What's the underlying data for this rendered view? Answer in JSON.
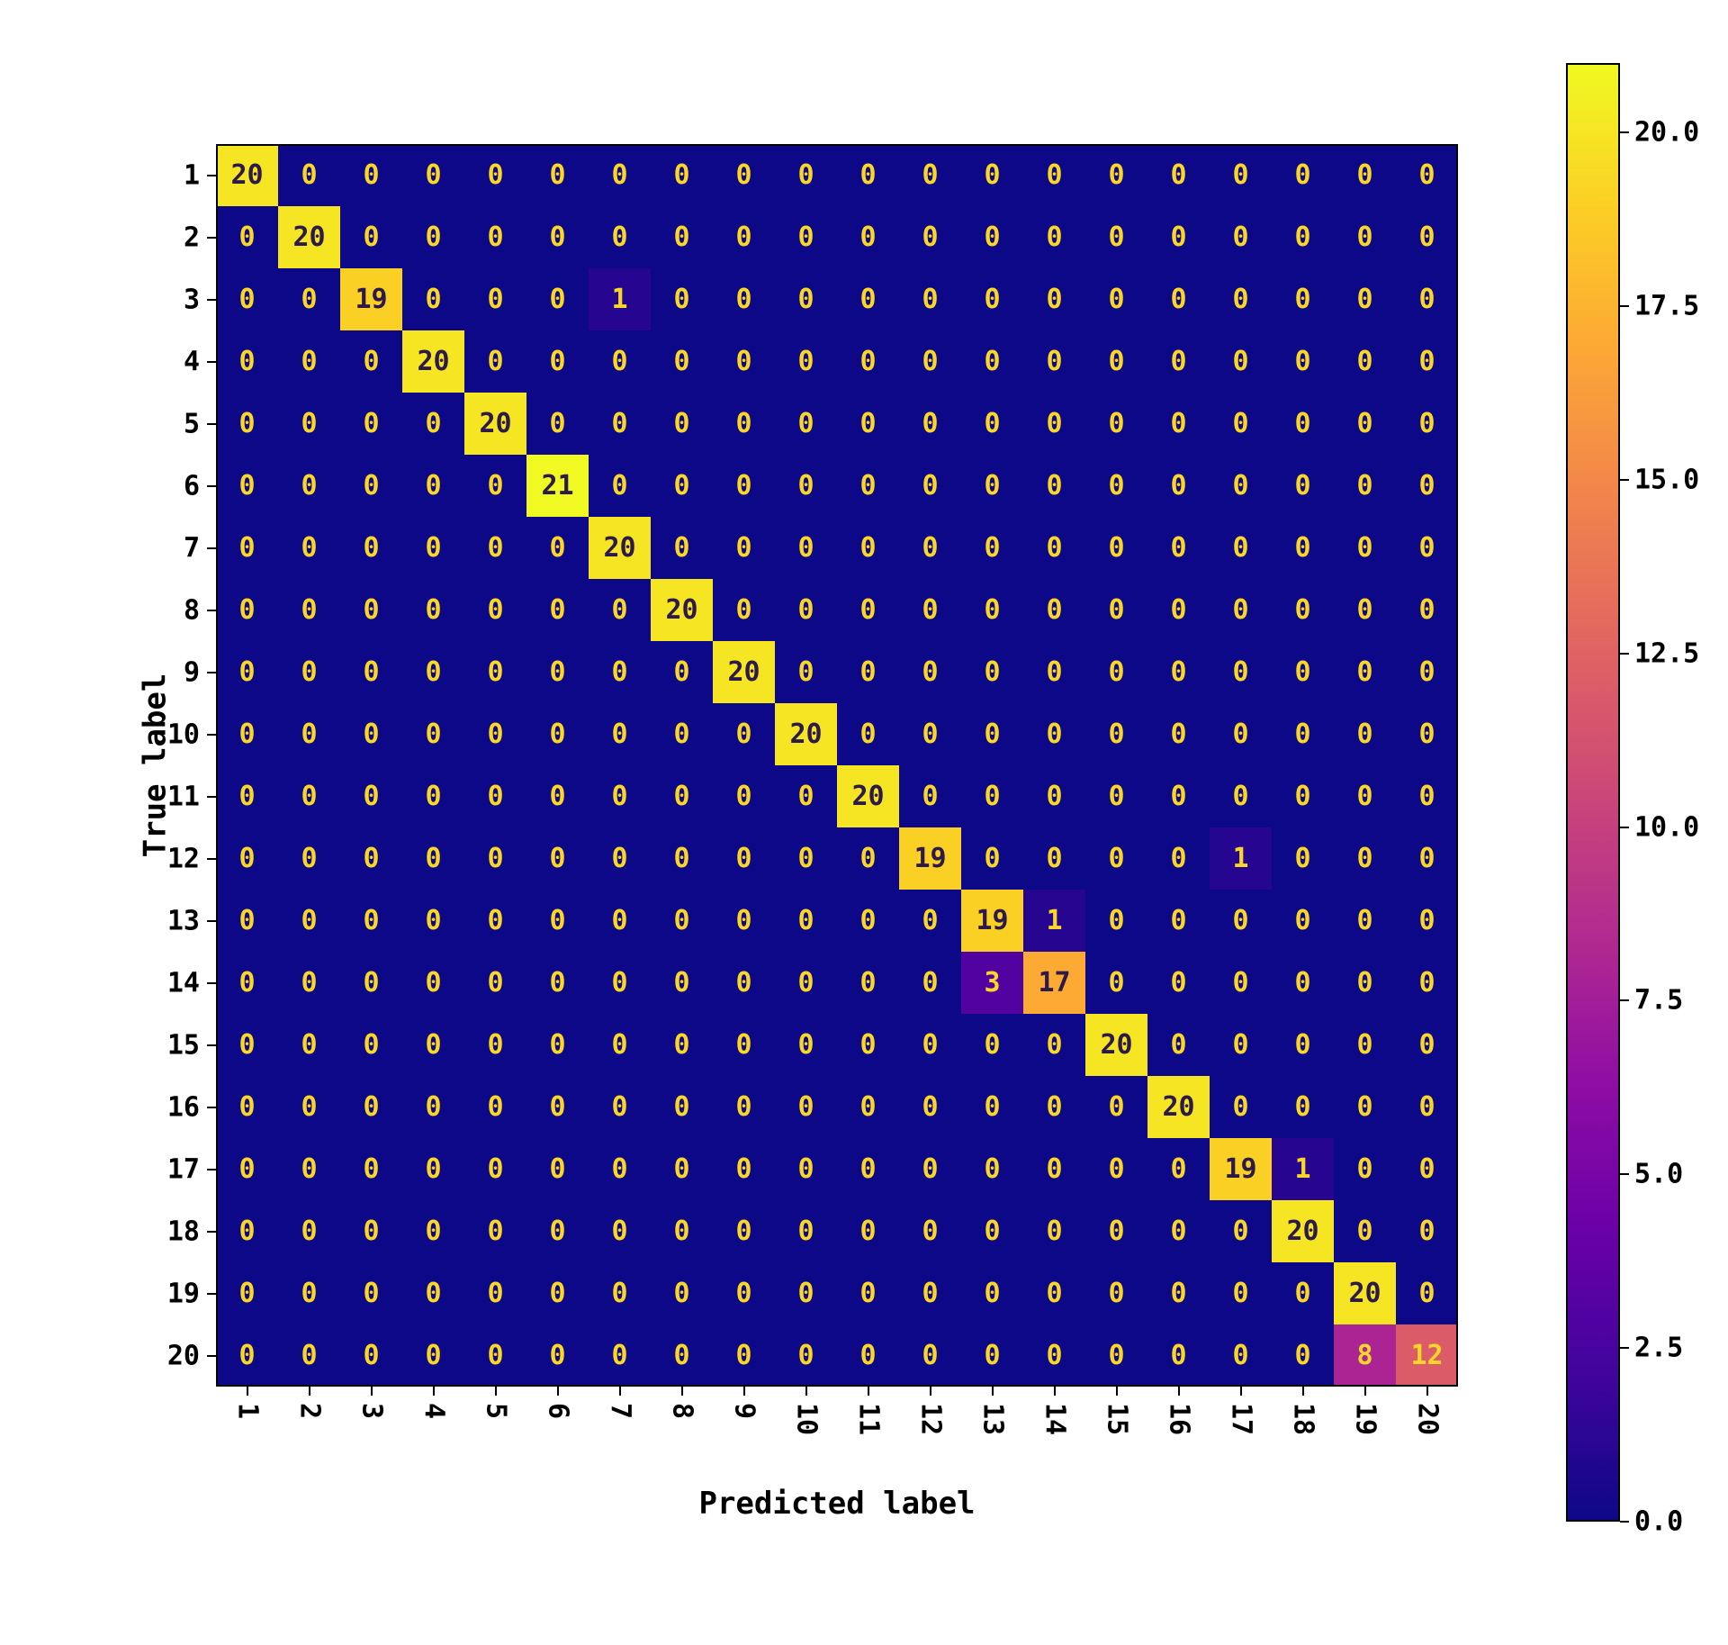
{
  "chart_data": {
    "type": "heatmap",
    "xlabel": "Predicted label",
    "ylabel": "True label",
    "categories_x": [
      "1",
      "2",
      "3",
      "4",
      "5",
      "6",
      "7",
      "8",
      "9",
      "10",
      "11",
      "12",
      "13",
      "14",
      "15",
      "16",
      "17",
      "18",
      "19",
      "20"
    ],
    "categories_y": [
      "1",
      "2",
      "3",
      "4",
      "5",
      "6",
      "7",
      "8",
      "9",
      "10",
      "11",
      "12",
      "13",
      "14",
      "15",
      "16",
      "17",
      "18",
      "19",
      "20"
    ],
    "matrix": [
      [
        20,
        0,
        0,
        0,
        0,
        0,
        0,
        0,
        0,
        0,
        0,
        0,
        0,
        0,
        0,
        0,
        0,
        0,
        0,
        0
      ],
      [
        0,
        20,
        0,
        0,
        0,
        0,
        0,
        0,
        0,
        0,
        0,
        0,
        0,
        0,
        0,
        0,
        0,
        0,
        0,
        0
      ],
      [
        0,
        0,
        19,
        0,
        0,
        0,
        1,
        0,
        0,
        0,
        0,
        0,
        0,
        0,
        0,
        0,
        0,
        0,
        0,
        0
      ],
      [
        0,
        0,
        0,
        20,
        0,
        0,
        0,
        0,
        0,
        0,
        0,
        0,
        0,
        0,
        0,
        0,
        0,
        0,
        0,
        0
      ],
      [
        0,
        0,
        0,
        0,
        20,
        0,
        0,
        0,
        0,
        0,
        0,
        0,
        0,
        0,
        0,
        0,
        0,
        0,
        0,
        0
      ],
      [
        0,
        0,
        0,
        0,
        0,
        21,
        0,
        0,
        0,
        0,
        0,
        0,
        0,
        0,
        0,
        0,
        0,
        0,
        0,
        0
      ],
      [
        0,
        0,
        0,
        0,
        0,
        0,
        20,
        0,
        0,
        0,
        0,
        0,
        0,
        0,
        0,
        0,
        0,
        0,
        0,
        0
      ],
      [
        0,
        0,
        0,
        0,
        0,
        0,
        0,
        20,
        0,
        0,
        0,
        0,
        0,
        0,
        0,
        0,
        0,
        0,
        0,
        0
      ],
      [
        0,
        0,
        0,
        0,
        0,
        0,
        0,
        0,
        20,
        0,
        0,
        0,
        0,
        0,
        0,
        0,
        0,
        0,
        0,
        0
      ],
      [
        0,
        0,
        0,
        0,
        0,
        0,
        0,
        0,
        0,
        20,
        0,
        0,
        0,
        0,
        0,
        0,
        0,
        0,
        0,
        0
      ],
      [
        0,
        0,
        0,
        0,
        0,
        0,
        0,
        0,
        0,
        0,
        20,
        0,
        0,
        0,
        0,
        0,
        0,
        0,
        0,
        0
      ],
      [
        0,
        0,
        0,
        0,
        0,
        0,
        0,
        0,
        0,
        0,
        0,
        19,
        0,
        0,
        0,
        0,
        1,
        0,
        0,
        0
      ],
      [
        0,
        0,
        0,
        0,
        0,
        0,
        0,
        0,
        0,
        0,
        0,
        0,
        19,
        1,
        0,
        0,
        0,
        0,
        0,
        0
      ],
      [
        0,
        0,
        0,
        0,
        0,
        0,
        0,
        0,
        0,
        0,
        0,
        0,
        3,
        17,
        0,
        0,
        0,
        0,
        0,
        0
      ],
      [
        0,
        0,
        0,
        0,
        0,
        0,
        0,
        0,
        0,
        0,
        0,
        0,
        0,
        0,
        20,
        0,
        0,
        0,
        0,
        0
      ],
      [
        0,
        0,
        0,
        0,
        0,
        0,
        0,
        0,
        0,
        0,
        0,
        0,
        0,
        0,
        0,
        20,
        0,
        0,
        0,
        0
      ],
      [
        0,
        0,
        0,
        0,
        0,
        0,
        0,
        0,
        0,
        0,
        0,
        0,
        0,
        0,
        0,
        0,
        19,
        1,
        0,
        0
      ],
      [
        0,
        0,
        0,
        0,
        0,
        0,
        0,
        0,
        0,
        0,
        0,
        0,
        0,
        0,
        0,
        0,
        0,
        20,
        0,
        0
      ],
      [
        0,
        0,
        0,
        0,
        0,
        0,
        0,
        0,
        0,
        0,
        0,
        0,
        0,
        0,
        0,
        0,
        0,
        0,
        20,
        0
      ],
      [
        0,
        0,
        0,
        0,
        0,
        0,
        0,
        0,
        0,
        0,
        0,
        0,
        0,
        0,
        0,
        0,
        0,
        0,
        8,
        12
      ]
    ],
    "vmin": 0.0,
    "vmax": 21.0,
    "colorbar_ticks": [
      "0.0",
      "2.5",
      "5.0",
      "7.5",
      "10.0",
      "12.5",
      "15.0",
      "17.5",
      "20.0"
    ],
    "colormap": "plasma"
  }
}
